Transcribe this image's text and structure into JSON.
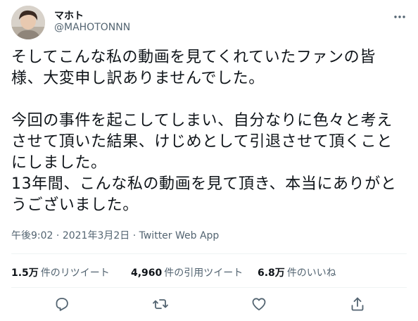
{
  "user": {
    "display_name": "マホト",
    "handle": "@MAHOTONNN"
  },
  "tweet": {
    "lines": [
      "そしてこんな私の動画を見てくれていたファンの皆",
      "様、大変申し訳ありませんでした。",
      "",
      "今回の事件を起こしてしまい、自分なりに色々と考え",
      "させて頂いた結果、けじめとして引退させて頂くこと",
      "にしました。",
      "13年間、こんな私の動画を見て頂き、本当にありがと",
      "うございました。"
    ],
    "time": "午後9:02",
    "separator": "·",
    "date": "2021年3月2日",
    "source": "Twitter Web App"
  },
  "stats": {
    "retweets": {
      "count": "1.5万",
      "label": "件のリツイート"
    },
    "quotes": {
      "count": "4,960",
      "label": "件の引用ツイート"
    },
    "likes": {
      "count": "6.8万",
      "label": "件のいいね"
    }
  },
  "icons": {
    "more": "more-icon",
    "reply": "reply-icon",
    "retweet": "retweet-icon",
    "like": "like-icon",
    "share": "share-icon"
  },
  "colors": {
    "text": "#0f1419",
    "secondary": "#536471",
    "divider": "#eff3f4"
  }
}
